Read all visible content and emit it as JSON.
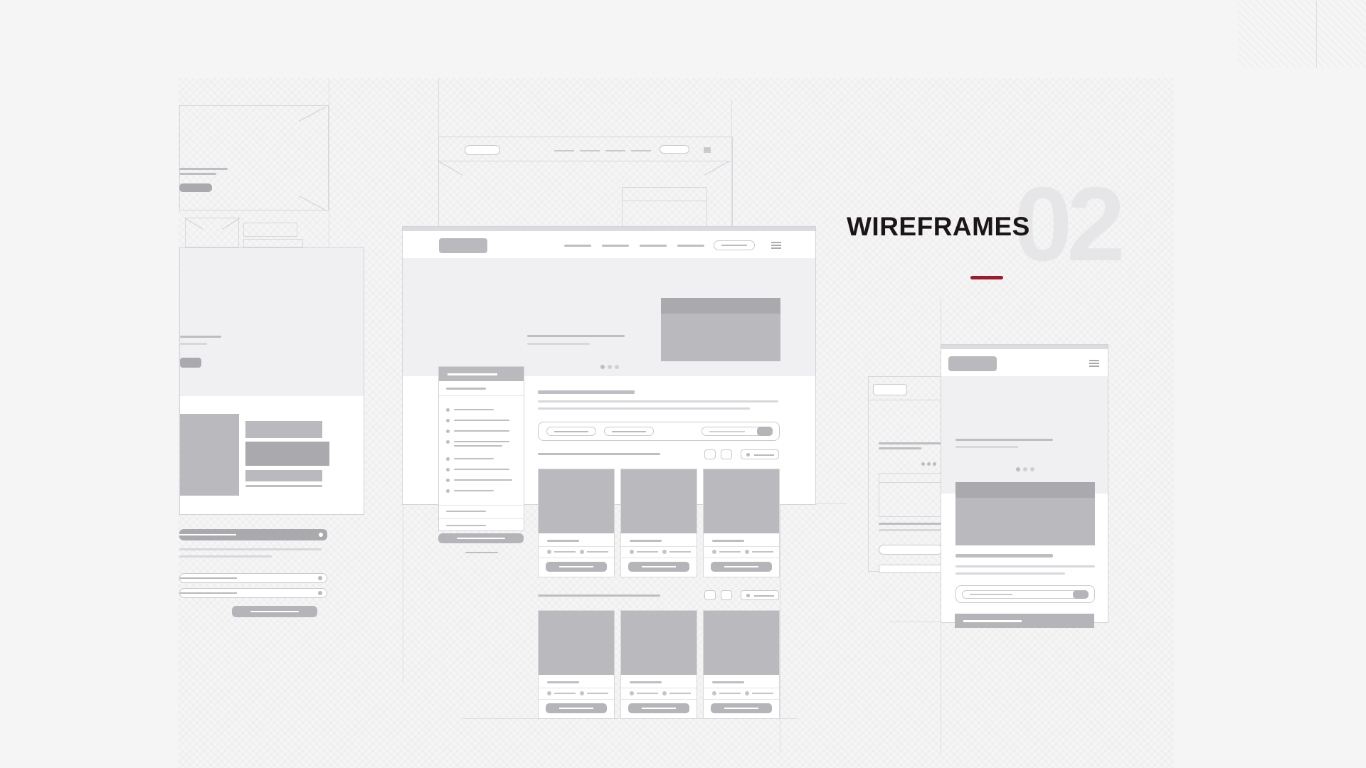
{
  "section": {
    "title": "WIREFRAMES",
    "number": "02",
    "accent_color": "#a0182b"
  },
  "artboards": [
    {
      "name": "left-partial-page",
      "kind": "desktop-wireframe"
    },
    {
      "name": "main-desktop-page",
      "kind": "desktop-wireframe"
    },
    {
      "name": "mobile-page",
      "kind": "mobile-wireframe"
    }
  ],
  "colors": {
    "background": "#f5f5f6",
    "placeholder": "#b9b9be",
    "placeholder_dark": "#a9a9ae",
    "frame_border": "#d4d4d8"
  }
}
